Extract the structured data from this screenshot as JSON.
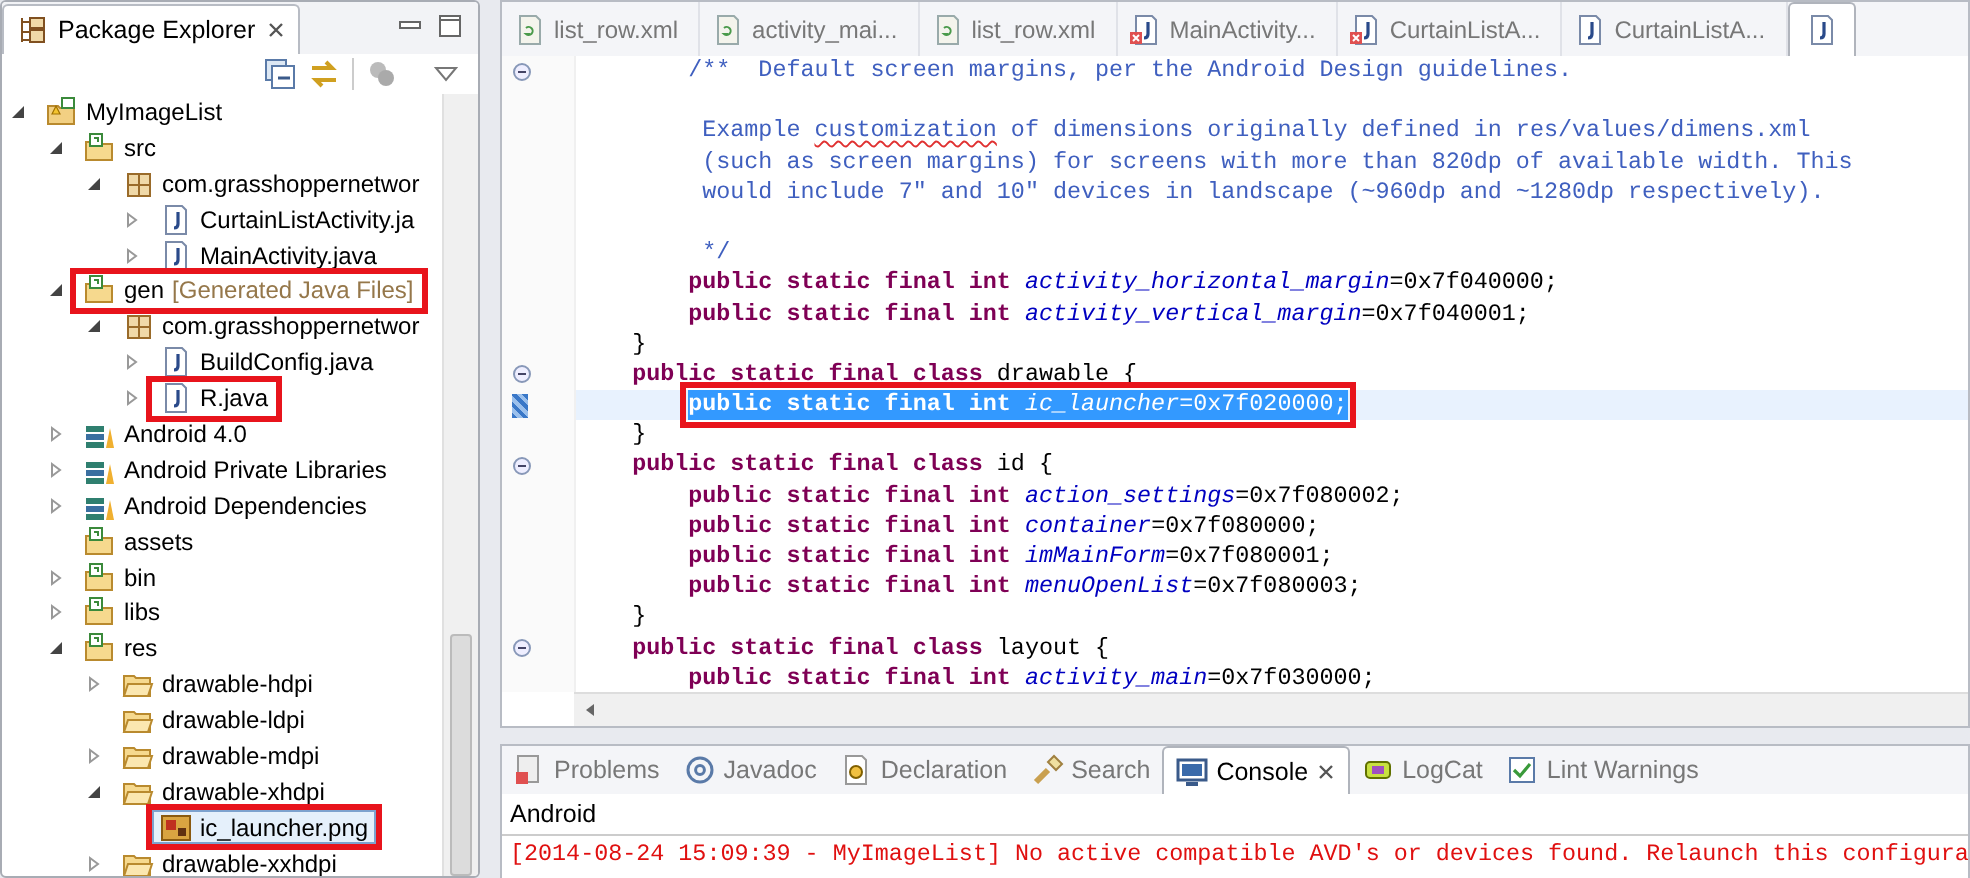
{
  "explorer": {
    "title": "Package Explorer",
    "tree": [
      {
        "label": "MyImageList",
        "kind": "project",
        "expanded": true,
        "selected": false,
        "annotated": false,
        "children": [
          {
            "label": "src",
            "kind": "source-folder",
            "expanded": true,
            "selected": false,
            "annotated": false,
            "children": [
              {
                "label": "com.grasshoppernetwor",
                "kind": "package",
                "expanded": true,
                "selected": false,
                "annotated": false,
                "children": [
                  {
                    "label": "CurtainListActivity.ja",
                    "kind": "java",
                    "expanded": false,
                    "selected": false,
                    "annotated": false
                  },
                  {
                    "label": "MainActivity.java",
                    "kind": "java",
                    "expanded": false,
                    "selected": false,
                    "annotated": false
                  }
                ]
              }
            ]
          },
          {
            "label": "gen",
            "decoration": "[Generated Java Files]",
            "kind": "source-folder",
            "expanded": true,
            "selected": false,
            "annotated": true,
            "children": [
              {
                "label": "com.grasshoppernetwor",
                "kind": "package",
                "expanded": true,
                "selected": false,
                "annotated": false,
                "children": [
                  {
                    "label": "BuildConfig.java",
                    "kind": "java",
                    "expanded": false,
                    "selected": false,
                    "annotated": false
                  },
                  {
                    "label": "R.java",
                    "kind": "java",
                    "expanded": false,
                    "selected": false,
                    "annotated": true
                  }
                ]
              }
            ]
          },
          {
            "label": "Android 4.0",
            "kind": "library",
            "expanded": false,
            "selected": false,
            "annotated": false
          },
          {
            "label": "Android Private Libraries",
            "kind": "library",
            "expanded": false,
            "selected": false,
            "annotated": false
          },
          {
            "label": "Android Dependencies",
            "kind": "library",
            "expanded": false,
            "selected": false,
            "annotated": false
          },
          {
            "label": "assets",
            "kind": "source-folder",
            "selected": false,
            "annotated": false
          },
          {
            "label": "bin",
            "kind": "source-folder",
            "expanded": false,
            "selected": false,
            "annotated": false
          },
          {
            "label": "libs",
            "kind": "source-folder",
            "expanded": false,
            "selected": false,
            "annotated": false
          },
          {
            "label": "res",
            "kind": "source-folder",
            "expanded": true,
            "selected": false,
            "annotated": false,
            "children": [
              {
                "label": "drawable-hdpi",
                "kind": "folder",
                "expanded": false,
                "selected": false,
                "annotated": false
              },
              {
                "label": "drawable-ldpi",
                "kind": "folder",
                "selected": false,
                "annotated": false
              },
              {
                "label": "drawable-mdpi",
                "kind": "folder",
                "expanded": false,
                "selected": false,
                "annotated": false
              },
              {
                "label": "drawable-xhdpi",
                "kind": "folder",
                "expanded": true,
                "selected": false,
                "annotated": false,
                "children": [
                  {
                    "label": "ic_launcher.png",
                    "kind": "image",
                    "selected": true,
                    "annotated": true
                  }
                ]
              },
              {
                "label": "drawable-xxhdpi",
                "kind": "folder",
                "expanded": false,
                "selected": false,
                "annotated": false
              }
            ]
          }
        ]
      }
    ]
  },
  "editor": {
    "tabs": [
      {
        "label": "list_row.xml",
        "kind": "xml",
        "error": false,
        "selected": false
      },
      {
        "label": "activity_mai...",
        "kind": "xml",
        "error": false,
        "selected": false
      },
      {
        "label": "list_row.xml",
        "kind": "xml",
        "error": false,
        "selected": false
      },
      {
        "label": "MainActivity...",
        "kind": "java",
        "error": true,
        "selected": false
      },
      {
        "label": "CurtainListA...",
        "kind": "java",
        "error": true,
        "selected": false
      },
      {
        "label": "CurtainListA...",
        "kind": "java",
        "error": false,
        "selected": false
      },
      {
        "kind": "java",
        "error": false,
        "selected": true
      }
    ],
    "lines": [
      {
        "kind": "code",
        "fold": true,
        "selected": false,
        "annotated": false,
        "tokens": [
          {
            "kind": "comment",
            "text": "        /**  Default screen margins, per the Android Design guidelines."
          }
        ]
      },
      {
        "kind": "blank"
      },
      {
        "kind": "code",
        "fold": false,
        "selected": false,
        "annotated": false,
        "tokens": [
          {
            "kind": "comment",
            "text": "         Example "
          },
          {
            "kind": "misspelled",
            "text": "customization"
          },
          {
            "kind": "comment",
            "text": " of dimensions originally defined in res/values/dimens.xml"
          }
        ]
      },
      {
        "kind": "code",
        "fold": false,
        "selected": false,
        "annotated": false,
        "tokens": [
          {
            "kind": "comment",
            "text": "         (such as screen margins) for screens with more than 820dp of available width. This"
          }
        ]
      },
      {
        "kind": "code",
        "fold": false,
        "selected": false,
        "annotated": false,
        "tokens": [
          {
            "kind": "comment",
            "text": "         would include 7\" and 10\" devices in landscape (~960dp and ~1280dp respectively)."
          }
        ]
      },
      {
        "kind": "blank"
      },
      {
        "kind": "code",
        "fold": false,
        "selected": false,
        "annotated": false,
        "tokens": [
          {
            "kind": "comment",
            "text": "         */"
          }
        ]
      },
      {
        "kind": "code",
        "fold": false,
        "selected": false,
        "annotated": false,
        "tokens": [
          {
            "kind": "keyword",
            "text": "        public static final int "
          },
          {
            "kind": "field",
            "text": "activity_horizontal_margin"
          },
          {
            "kind": "plain",
            "text": "=0x7f040000;"
          }
        ]
      },
      {
        "kind": "code",
        "fold": false,
        "selected": false,
        "annotated": false,
        "tokens": [
          {
            "kind": "keyword",
            "text": "        public static final int "
          },
          {
            "kind": "field",
            "text": "activity_vertical_margin"
          },
          {
            "kind": "plain",
            "text": "=0x7f040001;"
          }
        ]
      },
      {
        "kind": "code",
        "fold": false,
        "selected": false,
        "annotated": false,
        "tokens": [
          {
            "kind": "plain",
            "text": "    }"
          }
        ]
      },
      {
        "kind": "code",
        "fold": true,
        "selected": false,
        "annotated": false,
        "tokens": [
          {
            "kind": "keyword",
            "text": "    public static final class "
          },
          {
            "kind": "plain",
            "text": "drawable {"
          }
        ]
      },
      {
        "kind": "code",
        "fold": false,
        "selected": true,
        "annotated": true,
        "tokens": [
          {
            "kind": "keyword",
            "text": "        public static final int "
          },
          {
            "kind": "field",
            "text": "ic_launcher"
          },
          {
            "kind": "plain",
            "text": "=0x7f020000;"
          }
        ]
      },
      {
        "kind": "code",
        "fold": false,
        "selected": false,
        "annotated": false,
        "tokens": [
          {
            "kind": "plain",
            "text": "    }"
          }
        ]
      },
      {
        "kind": "code",
        "fold": true,
        "selected": false,
        "annotated": false,
        "tokens": [
          {
            "kind": "keyword",
            "text": "    public static final class "
          },
          {
            "kind": "plain",
            "text": "id {"
          }
        ]
      },
      {
        "kind": "code",
        "fold": false,
        "selected": false,
        "annotated": false,
        "tokens": [
          {
            "kind": "keyword",
            "text": "        public static final int "
          },
          {
            "kind": "field",
            "text": "action_settings"
          },
          {
            "kind": "plain",
            "text": "=0x7f080002;"
          }
        ]
      },
      {
        "kind": "code",
        "fold": false,
        "selected": false,
        "annotated": false,
        "tokens": [
          {
            "kind": "keyword",
            "text": "        public static final int "
          },
          {
            "kind": "field",
            "text": "container"
          },
          {
            "kind": "plain",
            "text": "=0x7f080000;"
          }
        ]
      },
      {
        "kind": "code",
        "fold": false,
        "selected": false,
        "annotated": false,
        "tokens": [
          {
            "kind": "keyword",
            "text": "        public static final int "
          },
          {
            "kind": "field",
            "text": "imMainForm"
          },
          {
            "kind": "plain",
            "text": "=0x7f080001;"
          }
        ]
      },
      {
        "kind": "code",
        "fold": false,
        "selected": false,
        "annotated": false,
        "tokens": [
          {
            "kind": "keyword",
            "text": "        public static final int "
          },
          {
            "kind": "field",
            "text": "menuOpenList"
          },
          {
            "kind": "plain",
            "text": "=0x7f080003;"
          }
        ]
      },
      {
        "kind": "code",
        "fold": false,
        "selected": false,
        "annotated": false,
        "tokens": [
          {
            "kind": "plain",
            "text": "    }"
          }
        ]
      },
      {
        "kind": "code",
        "fold": true,
        "selected": false,
        "annotated": false,
        "tokens": [
          {
            "kind": "keyword",
            "text": "    public static final class "
          },
          {
            "kind": "plain",
            "text": "layout {"
          }
        ]
      },
      {
        "kind": "code",
        "fold": false,
        "selected": false,
        "annotated": false,
        "tokens": [
          {
            "kind": "keyword",
            "text": "        public static final int "
          },
          {
            "kind": "field",
            "text": "activity_main"
          },
          {
            "kind": "plain",
            "text": "=0x7f030000;"
          }
        ]
      }
    ]
  },
  "console": {
    "tabs": [
      {
        "label": "Problems",
        "kind": "problems",
        "selected": false
      },
      {
        "label": "Javadoc",
        "kind": "javadoc",
        "selected": false
      },
      {
        "label": "Declaration",
        "kind": "declaration",
        "selected": false
      },
      {
        "label": "Search",
        "kind": "search",
        "selected": false
      },
      {
        "label": "Console",
        "kind": "console",
        "selected": true
      },
      {
        "label": "LogCat",
        "kind": "logcat",
        "selected": false
      },
      {
        "label": "Lint Warnings",
        "kind": "lint",
        "selected": false
      }
    ],
    "name": "Android",
    "lines": [
      {
        "kind": "error",
        "text": "[2014-08-24 15:09:39 - MyImageList] No active compatible AVD's or devices found. Relaunch this configura"
      }
    ]
  }
}
